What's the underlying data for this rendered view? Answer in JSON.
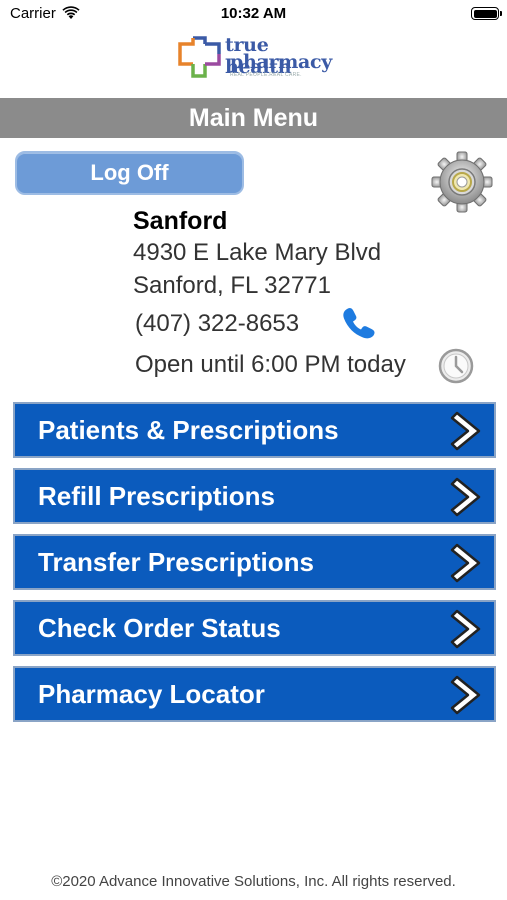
{
  "status_bar": {
    "carrier": "Carrier",
    "time": "10:32 AM"
  },
  "logo": {
    "line1": "true health",
    "line2": "pharmacy",
    "tagline": "REAL PEOPLE.REAL CARE."
  },
  "header": {
    "title": "Main Menu"
  },
  "logoff_label": "Log Off",
  "store": {
    "name": "Sanford",
    "address_line1": "4930 E Lake Mary Blvd",
    "address_line2": "Sanford, FL 32771",
    "phone": "(407) 322-8653",
    "hours": "Open until 6:00 PM today"
  },
  "menu": {
    "items": [
      {
        "label": "Patients & Prescriptions"
      },
      {
        "label": "Refill Prescriptions"
      },
      {
        "label": "Transfer Prescriptions"
      },
      {
        "label": "Check Order Status"
      },
      {
        "label": "Pharmacy Locator"
      }
    ]
  },
  "footer": "©2020 Advance Innovative Solutions, Inc. All rights reserved.",
  "colors": {
    "menu_button": "#0b5bbd",
    "header_bar": "#8b8b8b",
    "logoff_button": "#6d9bd7",
    "phone_icon": "#1e7be0"
  }
}
